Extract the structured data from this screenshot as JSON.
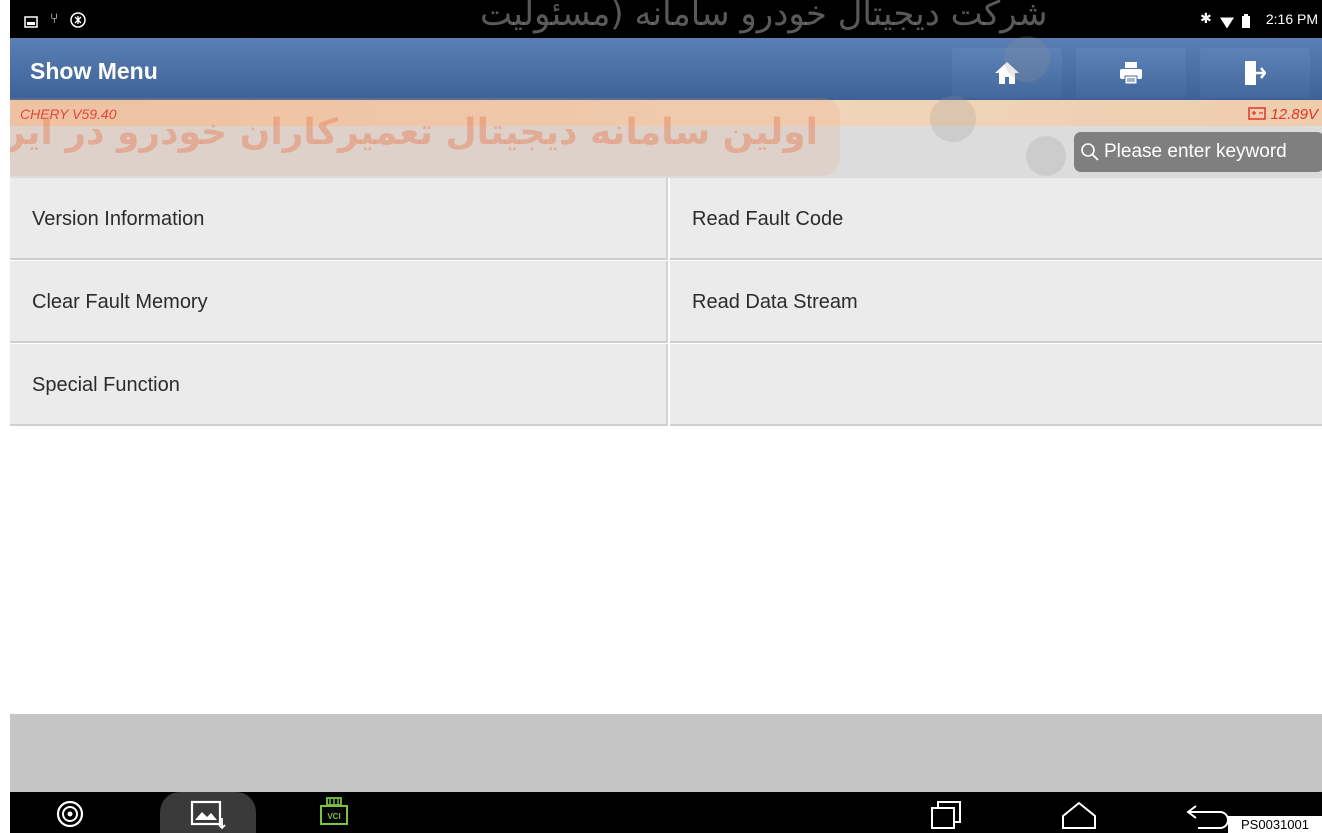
{
  "status_bar": {
    "time": "2:16 PM"
  },
  "titlebar": {
    "title": "Show Menu"
  },
  "info": {
    "version": "CHERY V59.40",
    "voltage": "12.89V"
  },
  "search": {
    "placeholder": "Please enter keyword"
  },
  "watermark": {
    "line1": "شرکت دیجیتال خودرو سامانه (مسئولیت",
    "line2": "اولین سامانه دیجیتال تعمیرکاران خودرو در ایران"
  },
  "menu": {
    "items": [
      {
        "label": "Version Information"
      },
      {
        "label": "Read Fault Code"
      },
      {
        "label": "Clear Fault Memory"
      },
      {
        "label": "Read Data Stream"
      },
      {
        "label": "Special Function"
      },
      {
        "label": ""
      }
    ]
  },
  "navbar": {
    "vci_label": "VCI"
  },
  "figure_code": "PS0031001",
  "colors": {
    "title_bar": "#4a6fa5",
    "accent_red": "#e2342a"
  },
  "icons": [
    "home-icon",
    "printer-icon",
    "exit-icon",
    "search-icon",
    "battery-icon",
    "car-tire-icon",
    "gallery-icon",
    "vci-icon",
    "recent-apps-icon",
    "home-nav-icon",
    "back-icon"
  ]
}
